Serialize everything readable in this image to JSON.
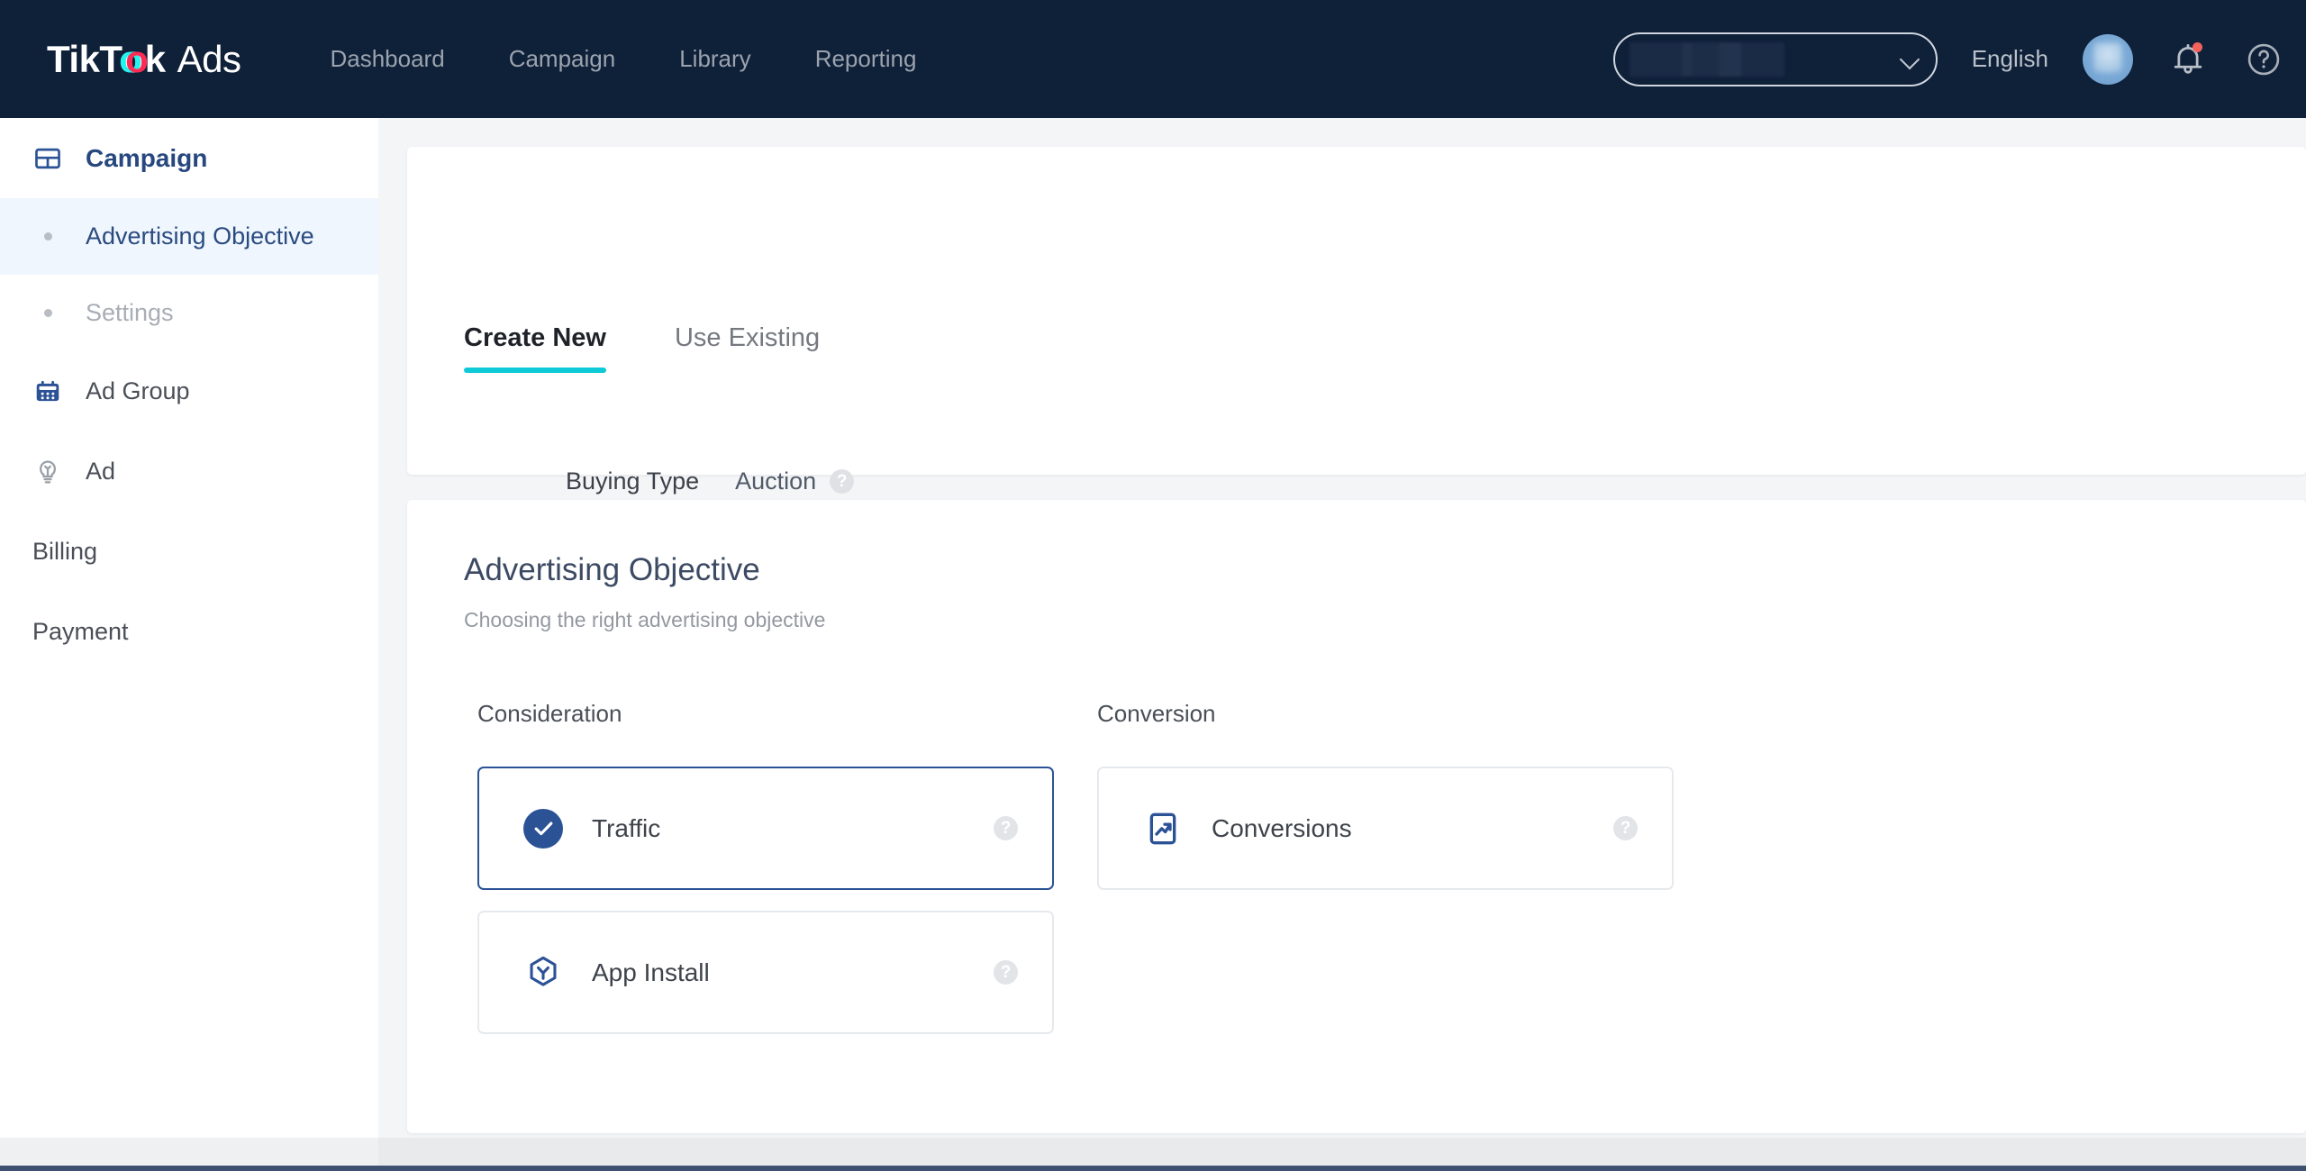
{
  "topnav": {
    "brand": {
      "bold_part": "TikT",
      "bold_o": "o",
      "bold_tail": "k",
      "light_part": "Ads"
    },
    "links": [
      {
        "label": "Dashboard",
        "name": "nav-link-dashboard"
      },
      {
        "label": "Campaign",
        "name": "nav-link-campaign"
      },
      {
        "label": "Library",
        "name": "nav-link-library"
      },
      {
        "label": "Reporting",
        "name": "nav-link-reporting"
      }
    ],
    "account_selector": {
      "value": "",
      "redacted": true,
      "icon": "chevron-down-icon"
    },
    "language": "English",
    "avatar": {
      "icon": "avatar"
    },
    "notifications": {
      "icon": "bell-icon",
      "has_unread": true,
      "dot_color": "#f4625c"
    },
    "help": {
      "icon": "question-circle-icon"
    },
    "background_color": "#0f2039"
  },
  "sidebar": {
    "items": [
      {
        "label": "Campaign",
        "icon": "layout-panel-icon",
        "state": "section-active"
      },
      {
        "label": "Advertising Objective",
        "icon": "bullet-dot-icon",
        "state": "sub-active"
      },
      {
        "label": "Settings",
        "icon": "bullet-dot-icon",
        "state": "sub-disabled"
      },
      {
        "label": "Ad Group",
        "icon": "calendar-icon",
        "state": "section"
      },
      {
        "label": "Ad",
        "icon": "lightbulb-icon",
        "state": "section"
      },
      {
        "label": "Billing",
        "icon": "",
        "state": "plain"
      },
      {
        "label": "Payment",
        "icon": "",
        "state": "plain"
      }
    ],
    "active_item": "Advertising Objective",
    "active_highlight_color": "#eff6fd",
    "accent_color": "#27477f"
  },
  "main": {
    "tabs": [
      {
        "label": "Create New",
        "active": true
      },
      {
        "label": "Use Existing",
        "active": false
      }
    ],
    "tab_underline_color": "#0ec9d8",
    "buying_type": {
      "label": "Buying Type",
      "value": "Auction",
      "help_icon": "question-circle-icon"
    },
    "objective_section": {
      "title": "Advertising Objective",
      "subtitle": "Choosing the right advertising objective",
      "columns": [
        {
          "heading": "Consideration",
          "cards": [
            {
              "label": "Traffic",
              "icon": "check-circle-icon",
              "selected": true,
              "help_icon": "question-circle-icon"
            },
            {
              "label": "App Install",
              "icon": "hexagon-app-install-icon",
              "selected": false,
              "help_icon": "question-circle-icon"
            }
          ]
        },
        {
          "heading": "Conversion",
          "cards": [
            {
              "label": "Conversions",
              "icon": "trending-up-square-icon",
              "selected": false,
              "help_icon": "question-circle-icon"
            }
          ]
        }
      ],
      "selected_border_color": "#2c5296",
      "unselected_border_color": "#e6e9ed"
    }
  },
  "colors": {
    "page_background": "#f4f5f7",
    "panel_background": "#ffffff",
    "nav_background": "#0f2039",
    "brand_cyan": "#25f4ee",
    "brand_pink": "#fe2c55",
    "accent_teal": "#0ec9d8",
    "accent_blue": "#2c5296"
  }
}
